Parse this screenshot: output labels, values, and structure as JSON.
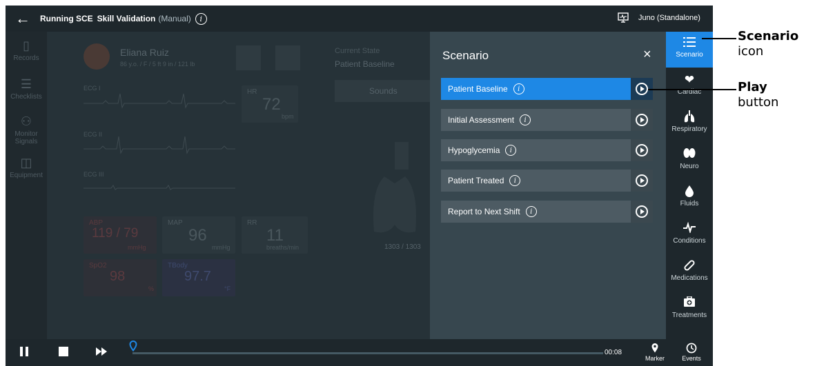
{
  "topbar": {
    "title_running": "Running SCE",
    "title_skill": "Skill Validation",
    "mode": "(Manual)",
    "info_glyph": "i",
    "device": "Juno (Standalone)"
  },
  "leftnav": [
    {
      "label": "Records",
      "icon": "clipboard-icon"
    },
    {
      "label": "Checklists",
      "icon": "checklist-icon"
    },
    {
      "label": "Monitor Signals",
      "icon": "monitor-signals-icon"
    },
    {
      "label": "Equipment",
      "icon": "equipment-icon"
    }
  ],
  "patient": {
    "name": "Eliana Ruiz",
    "details": "86 y.o. / F / 5 ft 9 in / 121 lb"
  },
  "state": {
    "label": "Current State",
    "value": "Patient Baseline",
    "sounds_button": "Sounds",
    "counter": "1303 / 1303"
  },
  "vitals": {
    "ecg1": "ECG I",
    "ecg2": "ECG II",
    "ecg3": "ECG III",
    "hr_label": "HR",
    "hr_value": "72",
    "hr_unit": "bpm",
    "abp_label": "ABP",
    "abp_value": "119 / 79",
    "abp_unit": "mmHg",
    "map_label": "MAP",
    "map_value": "96",
    "map_unit": "mmHg",
    "rr_label": "RR",
    "rr_value": "11",
    "rr_unit": "breaths/min",
    "spo2_label": "SpO2",
    "spo2_value": "98",
    "spo2_unit": "%",
    "tbody_label": "TBody",
    "tbody_value": "97.7",
    "tbody_unit": "°F"
  },
  "scenario": {
    "title": "Scenario",
    "close_glyph": "×",
    "items": [
      {
        "label": "Patient Baseline",
        "active": true
      },
      {
        "label": "Initial Assessment",
        "active": false
      },
      {
        "label": "Hypoglycemia",
        "active": false
      },
      {
        "label": "Patient Treated",
        "active": false
      },
      {
        "label": "Report to Next Shift",
        "active": false
      }
    ]
  },
  "rightnav": [
    {
      "label": "Scenario",
      "icon": "list-icon",
      "active": true
    },
    {
      "label": "Cardiac",
      "icon": "heart-icon",
      "active": false
    },
    {
      "label": "Respiratory",
      "icon": "lungs-icon",
      "active": false
    },
    {
      "label": "Neuro",
      "icon": "brain-icon",
      "active": false
    },
    {
      "label": "Fluids",
      "icon": "drop-icon",
      "active": false
    },
    {
      "label": "Conditions",
      "icon": "pulse-icon",
      "active": false
    },
    {
      "label": "Medications",
      "icon": "pill-icon",
      "active": false
    },
    {
      "label": "Treatments",
      "icon": "first-aid-icon",
      "active": false
    }
  ],
  "bottombar": {
    "elapsed": "00:08",
    "progress": 0.0,
    "marker_label": "Marker",
    "events_label": "Events"
  },
  "callouts": {
    "scenario_bold": "Scenario",
    "scenario_rest": "icon",
    "play_bold": "Play",
    "play_rest": "button"
  },
  "colors": {
    "accent": "#1e88e5",
    "background": "#263238",
    "panel": "#37474f"
  }
}
